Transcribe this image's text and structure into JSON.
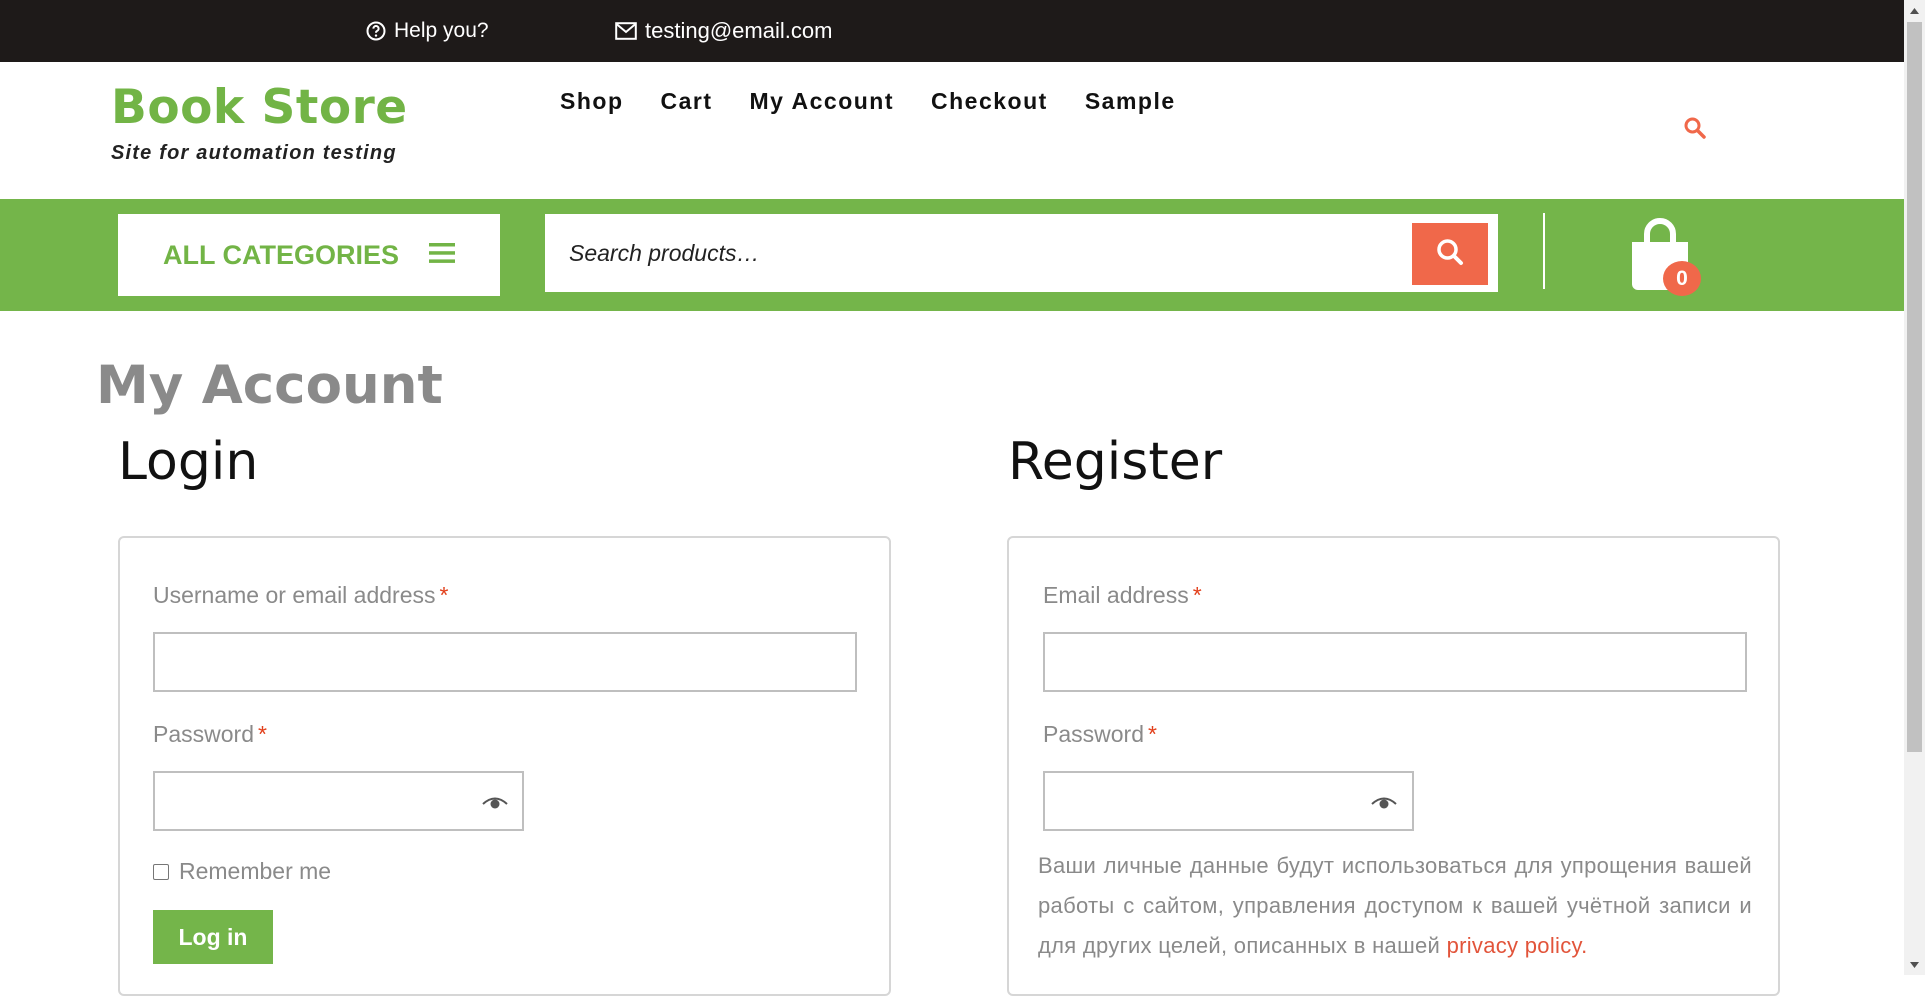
{
  "topbar": {
    "help_text": "Help you?",
    "email_text": "testing@email.com"
  },
  "brand": {
    "title": "Book Store",
    "tagline": "Site for automation testing"
  },
  "nav": {
    "items": [
      "Shop",
      "Cart",
      "My Account",
      "Checkout",
      "Sample"
    ]
  },
  "categories": {
    "label": "ALL CATEGORIES"
  },
  "search": {
    "placeholder": "Search products…"
  },
  "cart": {
    "count": "0"
  },
  "page": {
    "title": "My Account"
  },
  "login": {
    "heading": "Login",
    "username_label": "Username or email address",
    "password_label": "Password",
    "required_mark": "*",
    "remember_label": "Remember me",
    "submit_label": "Log in"
  },
  "register": {
    "heading": "Register",
    "email_label": "Email address",
    "password_label": "Password",
    "required_mark": "*",
    "privacy_text": "Ваши личные данные будут использоваться для упрощения вашей работы с сайтом, управления доступом к вашей учётной записи и для других целей, описанных в нашей ",
    "privacy_link": "privacy policy."
  },
  "colors": {
    "brand_green": "#74b54a",
    "accent_orange": "#f0684a",
    "topbar_bg": "#1e1a19"
  },
  "icons": [
    "question-circle-icon",
    "envelope-icon",
    "search-icon",
    "hamburger-icon",
    "shopping-bag-icon",
    "eye-icon"
  ]
}
